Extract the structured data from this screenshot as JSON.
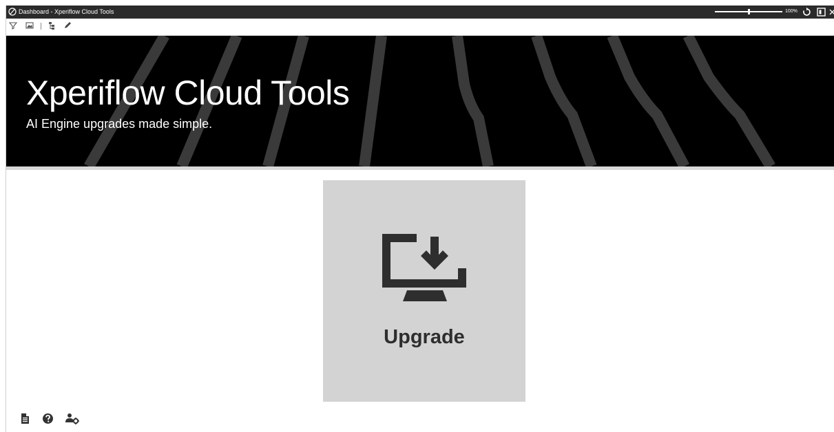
{
  "window": {
    "title": "Dashboard - Xperiflow Cloud Tools",
    "zoom_label": "100%"
  },
  "toolbar": {
    "icons": [
      "filter-icon",
      "image-icon",
      "hierarchy-icon",
      "pencil-icon"
    ]
  },
  "banner": {
    "title": "Xperiflow Cloud Tools",
    "subtitle": "AI Engine upgrades made simple."
  },
  "tile": {
    "label": "Upgrade",
    "icon": "download-to-computer-icon",
    "background": "#d3d3d3"
  },
  "footer": {
    "icons": [
      "document-icon",
      "help-icon",
      "user-settings-icon"
    ]
  },
  "colors": {
    "titlebar": "#2b2b2b",
    "banner": "#000000",
    "stripe": "#3a3a3a",
    "icon": "#2e2e2e"
  }
}
